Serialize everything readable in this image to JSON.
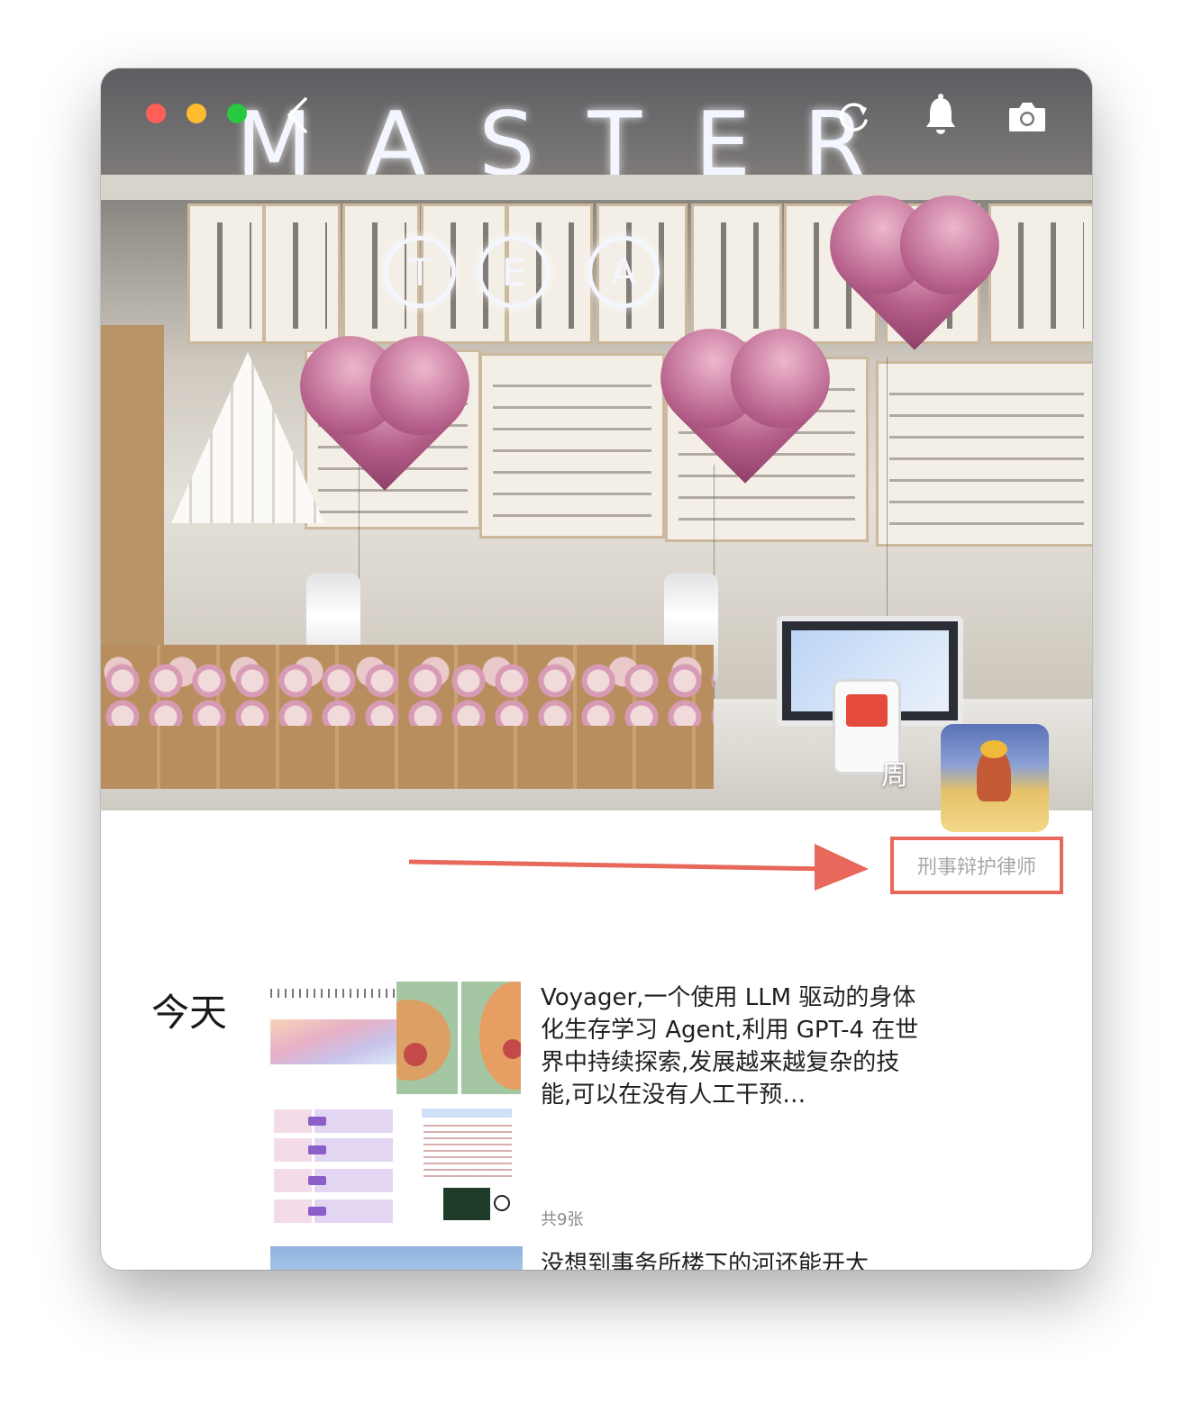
{
  "toolbar": {
    "back_icon": "chevron-left-icon",
    "refresh_icon": "refresh-icon",
    "notification_icon": "bell-icon",
    "camera_icon": "camera-icon"
  },
  "window_controls": {
    "close_color": "#ff5f57",
    "minimize_color": "#febc2e",
    "zoom_color": "#28c840"
  },
  "cover": {
    "sign_letters": [
      "M",
      "A",
      "S",
      "T",
      "E",
      "R"
    ],
    "badge_letters": [
      "T",
      "E",
      "A"
    ]
  },
  "profile": {
    "name": "周",
    "bio": "刑事辩护律师",
    "highlight_color": "#e8695b"
  },
  "feed": {
    "sections": [
      {
        "date": "今天",
        "posts": [
          {
            "text": "Voyager,一个使用 LLM 驱动的身体化生存学习 Agent,利用 GPT-4 在世界中持续探索,发展越来越复杂的技能,可以在没有人工干预…",
            "count": "共9张"
          },
          {
            "text": "没想到事务所楼下的河还能开大"
          }
        ]
      }
    ]
  }
}
